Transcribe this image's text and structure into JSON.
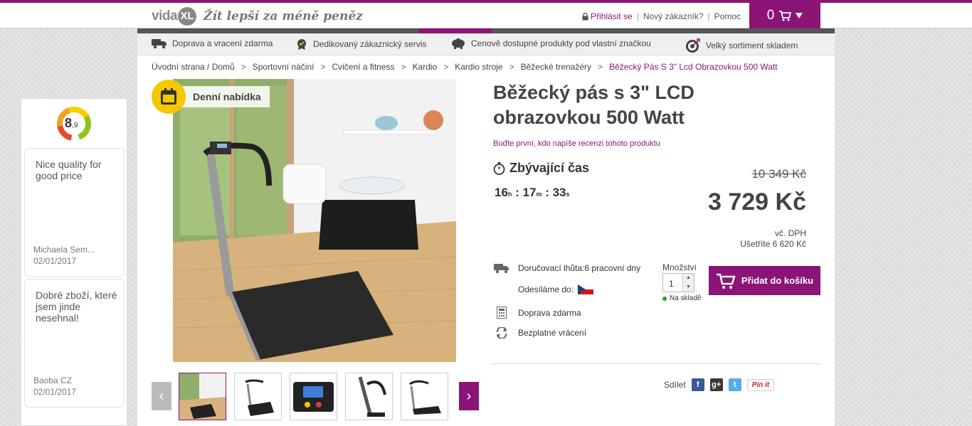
{
  "header": {
    "logo_text": "vida",
    "logo_xl": "XL",
    "tagline": "Žít lepší za méně peněz",
    "login": "Přihlásit se",
    "new_customer": "Nový zákazník?",
    "help": "Pomoc",
    "cart_count": "0",
    "accent_color": "#8a1577"
  },
  "usp": {
    "delivery": "Doprava a vracení zdarma",
    "service": "Dedikovaný zákaznický servis",
    "prices": "Cenově dostupné produkty pod vlastní značkou",
    "assortment": "Velký sortiment skladem"
  },
  "breadcrumb": [
    "Úvodní strana / Domů",
    "Sportovní náčiní",
    "Cvičení a fitness",
    "Kardio",
    "Kardio stroje",
    "Běžecké trenažéry",
    "Běžecký Pás S 3\" Lcd Obrazovkou 500 Watt"
  ],
  "deal": {
    "label": "Denní nabídka"
  },
  "product": {
    "title": "Běžecký pás s 3\" LCD obrazovkou 500 Watt",
    "review_link": "Buďte první, kdo napíše recenzi tohoto produktu",
    "timer_label": "Zbývající čas",
    "timer": {
      "hours": "16",
      "h_unit": "h",
      "minutes": "17",
      "m_unit": "m",
      "seconds": "33",
      "s_unit": "s"
    },
    "old_price": "10 349 Kč",
    "new_price": "3 729 Kč",
    "vat": "vč. DPH",
    "savings": "Ušetříte 6 620 Kč",
    "delivery_time": "Doručovací lhůta:6 pracovní dny",
    "ship_from": "Odesíláme do:",
    "free_shipping": "Doprava zdarma",
    "free_returns": "Bezplatné vrácení",
    "qty_label": "Množství",
    "qty_value": "1",
    "stock": "Na skladě",
    "add_to_cart": "Přidat do košíku",
    "share_label": "Sdílet",
    "pin_label": "Pin it"
  },
  "reviews_widget": {
    "rating_main": "8",
    "rating_decimal": ",9",
    "reviews": [
      {
        "text": "Nice quality for good price",
        "author": "Michaela Sem...",
        "date": "02/01/2017"
      },
      {
        "text": "Dobré zboží, které jsem jinde nesehnal!",
        "author": "Baoba CZ",
        "date": "02/01/2017"
      }
    ]
  }
}
